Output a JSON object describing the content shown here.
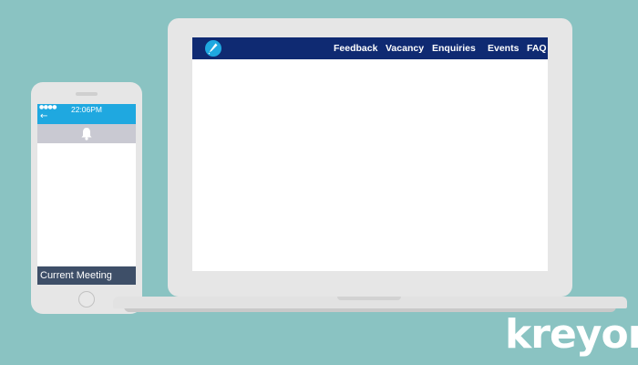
{
  "phone": {
    "signal": "●●●●",
    "back_glyph": "←",
    "time": "22:06PM",
    "bell_icon": "bell-icon",
    "footer_label": "Current Meeting",
    "status_color": "#1fa8e0",
    "footer_color": "#3e4f68"
  },
  "laptop": {
    "logo_icon": "pen-logo-icon",
    "nav": {
      "feedback": "Feedback",
      "vacancy": "Vacancy",
      "enquiries": "Enquiries",
      "events": "Events",
      "faq": "FAQ"
    },
    "nav_color": "#0f2a72"
  },
  "brand": {
    "name": "kreyon"
  },
  "colors": {
    "background": "#8ac3c2",
    "device": "#e6e6e6"
  }
}
